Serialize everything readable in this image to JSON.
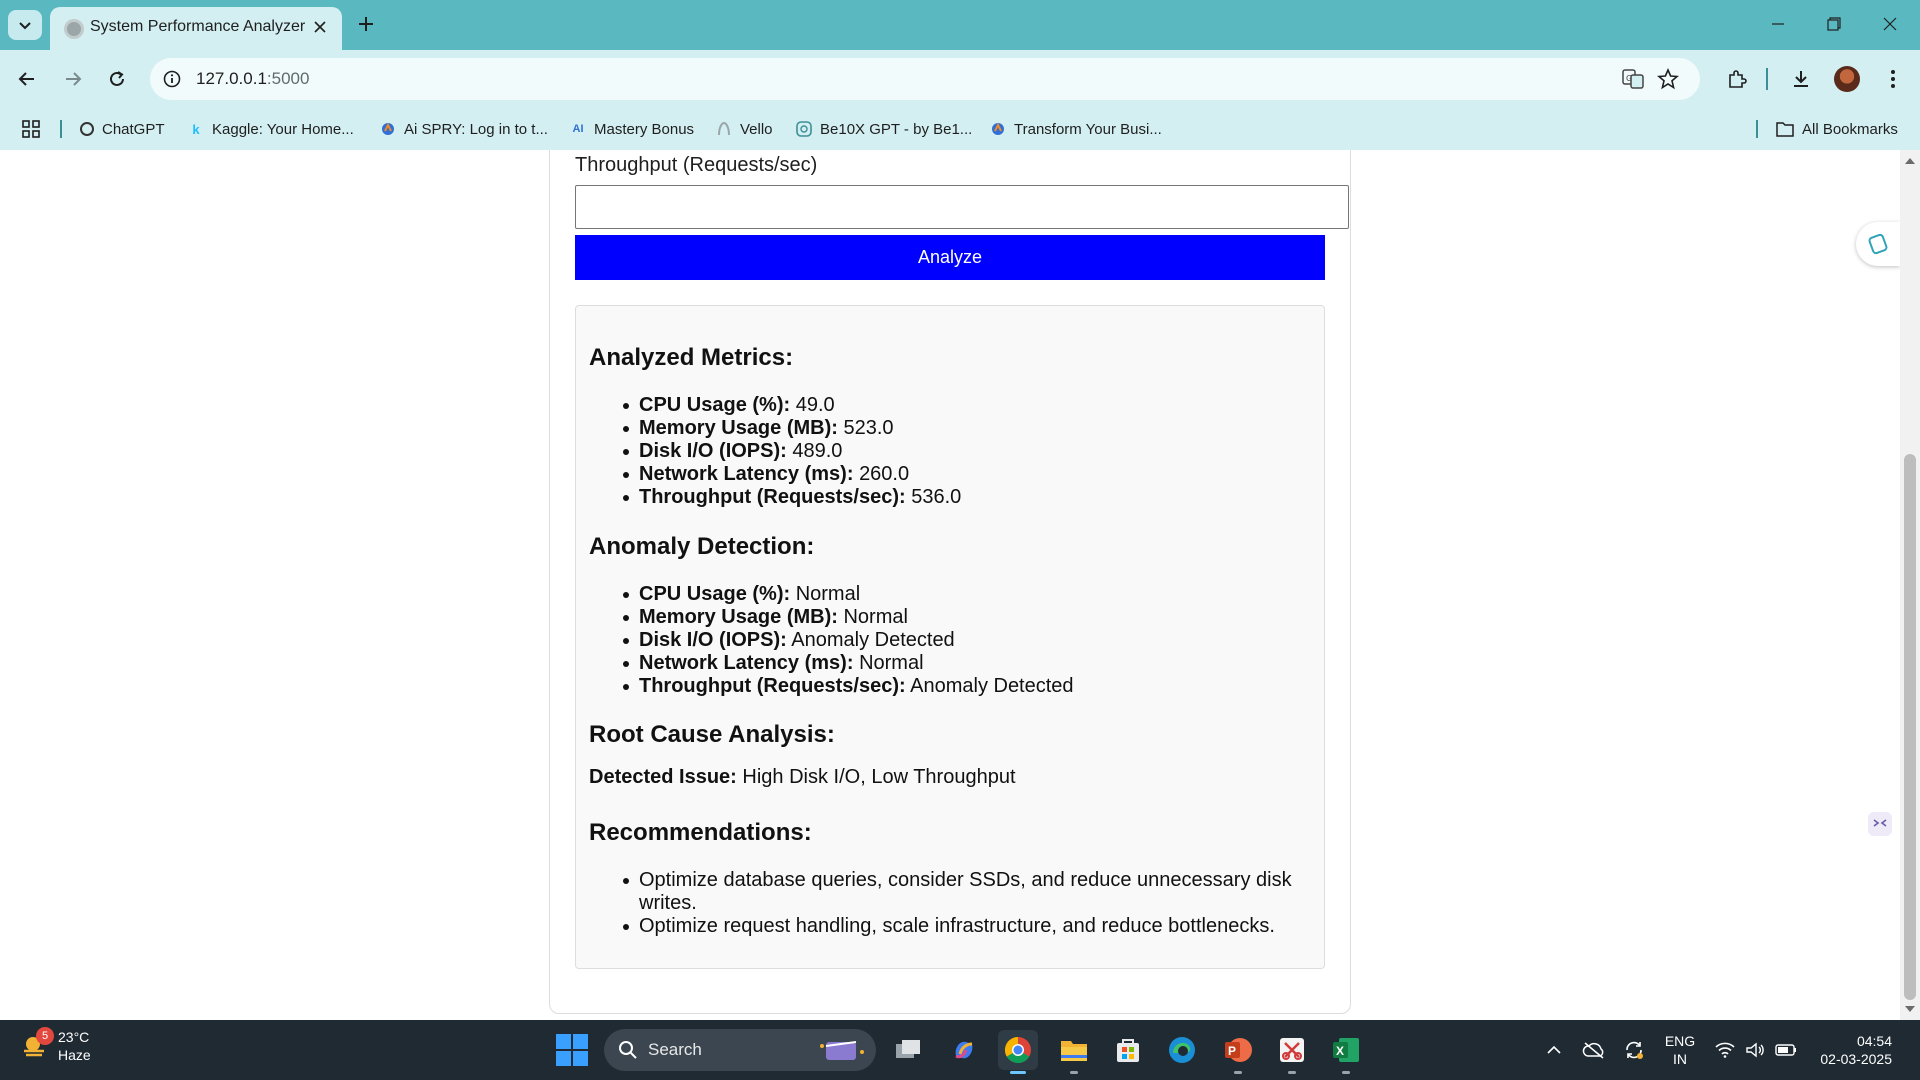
{
  "browser": {
    "tab_title": "System Performance Analyzer",
    "url_host": "127.0.0.1",
    "url_port": ":5000",
    "bookmarks": [
      {
        "label": "ChatGPT",
        "icon": "chatgpt-icon"
      },
      {
        "label": "Kaggle: Your Home...",
        "icon": "kaggle-icon"
      },
      {
        "label": "Ai SPRY: Log in to t...",
        "icon": "aispry-icon"
      },
      {
        "label": "Mastery Bonus",
        "icon": "mastery-icon"
      },
      {
        "label": "Vello",
        "icon": "vello-icon"
      },
      {
        "label": "Be10X GPT - by Be1...",
        "icon": "be10x-icon"
      },
      {
        "label": "Transform Your Busi...",
        "icon": "transform-icon"
      }
    ],
    "all_bookmarks_label": "All Bookmarks"
  },
  "form": {
    "throughput_label": "Throughput (Requests/sec)",
    "throughput_value": "",
    "analyze_label": "Analyze"
  },
  "results": {
    "metrics_heading": "Analyzed Metrics:",
    "metrics": [
      {
        "name": "CPU Usage (%):",
        "value": "49.0"
      },
      {
        "name": "Memory Usage (MB):",
        "value": "523.0"
      },
      {
        "name": "Disk I/O (IOPS):",
        "value": "489.0"
      },
      {
        "name": "Network Latency (ms):",
        "value": "260.0"
      },
      {
        "name": "Throughput (Requests/sec):",
        "value": "536.0"
      }
    ],
    "anomaly_heading": "Anomaly Detection:",
    "anomalies": [
      {
        "name": "CPU Usage (%):",
        "value": "Normal"
      },
      {
        "name": "Memory Usage (MB):",
        "value": "Normal"
      },
      {
        "name": "Disk I/O (IOPS):",
        "value": "Anomaly Detected"
      },
      {
        "name": "Network Latency (ms):",
        "value": "Normal"
      },
      {
        "name": "Throughput (Requests/sec):",
        "value": "Anomaly Detected"
      }
    ],
    "root_cause_heading": "Root Cause Analysis:",
    "detected_issue_label": "Detected Issue:",
    "detected_issue_value": "High Disk I/O, Low Throughput",
    "recommendations_heading": "Recommendations:",
    "recommendations": [
      "Optimize database queries, consider SSDs, and reduce unnecessary disk writes.",
      "Optimize request handling, scale infrastructure, and reduce bottlenecks."
    ]
  },
  "taskbar": {
    "weather_temp": "23°C",
    "weather_desc": "Haze",
    "weather_badge": "5",
    "search_label": "Search",
    "lang_top": "ENG",
    "lang_bottom": "IN",
    "time": "04:54",
    "date": "02-03-2025"
  },
  "colors": {
    "analyze_button": "#0000ff",
    "titlebar": "#5ab8c1",
    "toolbar": "#d3eff2"
  }
}
